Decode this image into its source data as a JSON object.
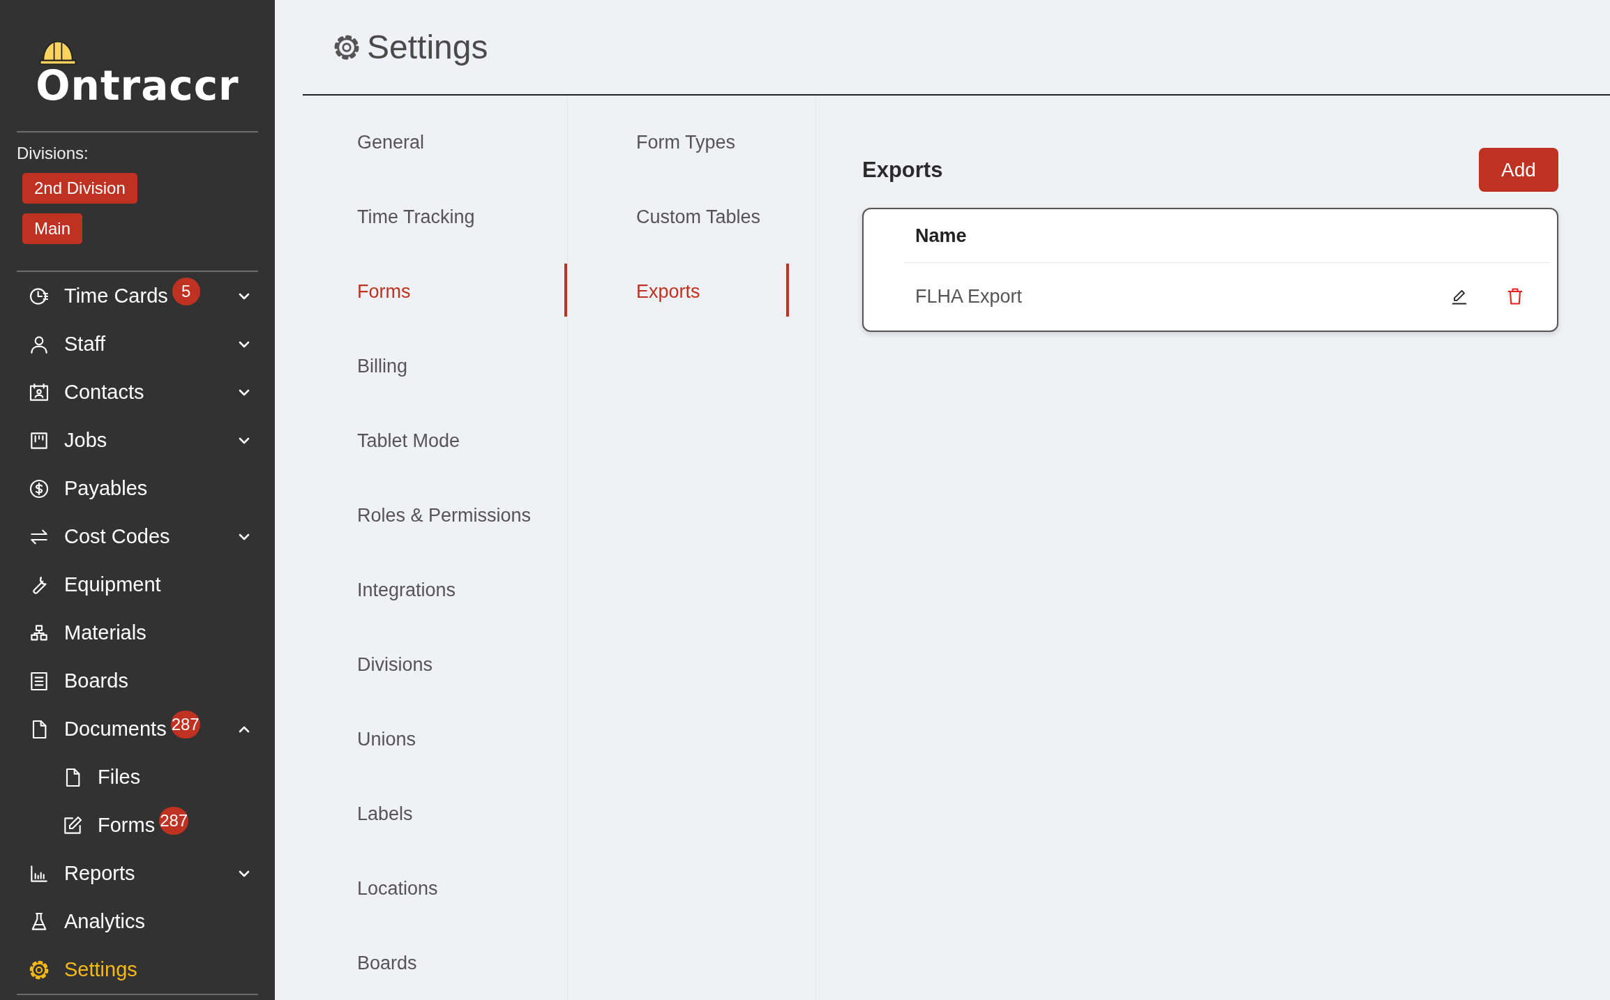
{
  "sidebar": {
    "logo": "Ontraccr",
    "divisions_label": "Divisions:",
    "divisions": [
      "2nd Division",
      "Main"
    ],
    "nav": [
      {
        "label": "Time Cards",
        "badge": "5",
        "expanded": false,
        "selected": false
      },
      {
        "label": "Staff",
        "expanded": false,
        "selected": false
      },
      {
        "label": "Contacts",
        "expanded": false,
        "selected": false
      },
      {
        "label": "Jobs",
        "expanded": false,
        "selected": false
      },
      {
        "label": "Payables",
        "selected": false
      },
      {
        "label": "Cost Codes",
        "expanded": false,
        "selected": false
      },
      {
        "label": "Equipment",
        "selected": false
      },
      {
        "label": "Materials",
        "selected": false
      },
      {
        "label": "Boards",
        "selected": false
      },
      {
        "label": "Documents",
        "badge": "287",
        "expanded": true,
        "selected": false,
        "children": [
          {
            "label": "Files",
            "selected": false
          },
          {
            "label": "Forms",
            "badge": "287",
            "selected": false
          }
        ]
      },
      {
        "label": "Reports",
        "expanded": false,
        "selected": false
      },
      {
        "label": "Analytics",
        "selected": false
      },
      {
        "label": "Settings",
        "selected": true
      }
    ]
  },
  "header": {
    "title": "Settings"
  },
  "settings_menu": [
    {
      "label": "General",
      "selected": false
    },
    {
      "label": "Time Tracking",
      "selected": false
    },
    {
      "label": "Forms",
      "selected": true
    },
    {
      "label": "Billing",
      "selected": false
    },
    {
      "label": "Tablet Mode",
      "selected": false
    },
    {
      "label": "Roles & Permissions",
      "selected": false
    },
    {
      "label": "Integrations",
      "selected": false
    },
    {
      "label": "Divisions",
      "selected": false
    },
    {
      "label": "Unions",
      "selected": false
    },
    {
      "label": "Labels",
      "selected": false
    },
    {
      "label": "Locations",
      "selected": false
    },
    {
      "label": "Boards",
      "selected": false
    }
  ],
  "forms_menu": [
    {
      "label": "Form Types",
      "selected": false
    },
    {
      "label": "Custom Tables",
      "selected": false
    },
    {
      "label": "Exports",
      "selected": true
    }
  ],
  "exports": {
    "title": "Exports",
    "add_button": "Add",
    "columns": [
      "Name"
    ],
    "rows": [
      {
        "name": "FLHA Export"
      }
    ]
  }
}
